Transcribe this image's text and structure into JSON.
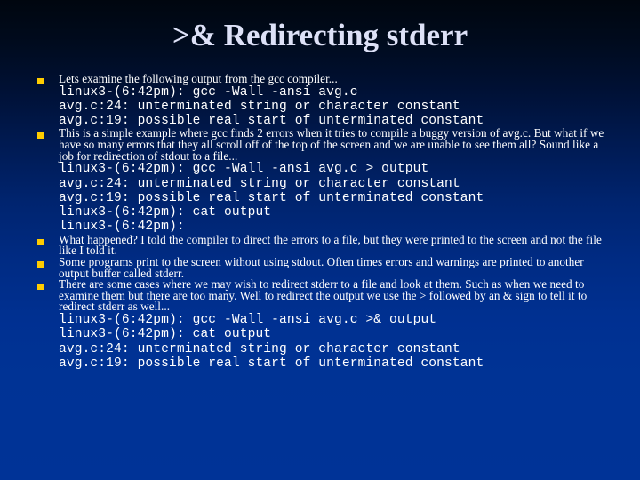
{
  "slide": {
    "title": ">& Redirecting stderr",
    "background": {
      "top_color": "#00060f",
      "bottom_color": "#003397"
    },
    "title_color": "#dde1f7",
    "bullet_color": "#ffcc00",
    "text_color": "#ffffff"
  },
  "blocks": [
    {
      "id": "block-1",
      "bullet": "square",
      "prose": [
        "Lets examine the following output from the gcc compiler..."
      ],
      "terminal": [
        "linux3-(6:42pm): gcc -Wall -ansi avg.c",
        "avg.c:24: unterminated string or character constant",
        "avg.c:19: possible real start of unterminated constant"
      ]
    },
    {
      "id": "block-2",
      "bullet": "square",
      "prose": [
        "This is a simple example where gcc finds 2 errors when it tries to compile a buggy version of avg.c. But what if we have so many errors that they all scroll off of the top of the screen and we are unable to see them all? Sound like a job for redirection of stdout to a file..."
      ],
      "terminal": [
        "linux3-(6:42pm): gcc -Wall -ansi avg.c > output",
        "avg.c:24: unterminated string or character constant",
        "avg.c:19: possible real start of unterminated constant",
        "linux3-(6:42pm): cat output",
        "linux3-(6:42pm):"
      ]
    },
    {
      "id": "block-3",
      "bullet": "square",
      "prose": [
        "What happened? I told the compiler to direct the errors to a file, but they were printed to the screen and not the file like I told it."
      ],
      "terminal": []
    },
    {
      "id": "block-4",
      "bullet": "square",
      "prose": [
        "Some programs print to the screen without using stdout. Often times errors and warnings are printed to another output buffer called stderr."
      ],
      "terminal": []
    },
    {
      "id": "block-5",
      "bullet": "square",
      "prose": [
        "There are some cases where we may wish to redirect stderr to a file and look at them. Such as when we need to examine them but there are too many. Well to redirect the output we use the > followed by an & sign to tell it to redirect stderr as well..."
      ],
      "terminal": [
        "linux3-(6:42pm): gcc -Wall -ansi avg.c >& output",
        "linux3-(6:42pm): cat output",
        "avg.c:24: unterminated string or character constant",
        "avg.c:19: possible real start of unterminated constant"
      ]
    }
  ]
}
